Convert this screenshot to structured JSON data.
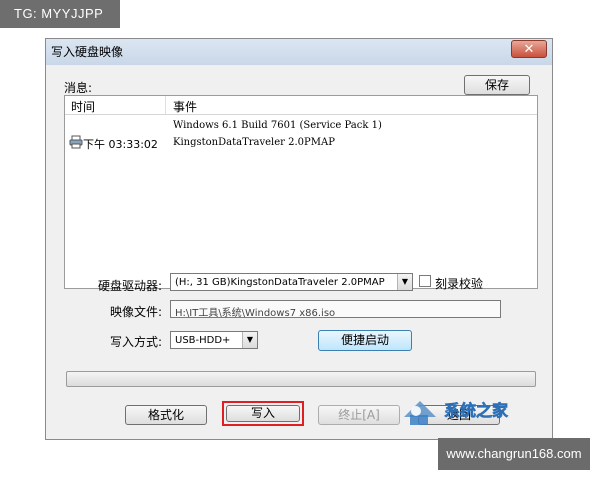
{
  "watermarks": {
    "top": "TG: MYYJJPP",
    "bottom": "www.changrun168.com",
    "logo_text": "系统之家"
  },
  "window": {
    "title": "写入硬盘映像",
    "close_symbol": "✕"
  },
  "messages": {
    "label": "消息:",
    "save_button": "保存",
    "columns": [
      "时间",
      "事件"
    ],
    "rows": [
      {
        "time": "",
        "event": "Windows 6.1 Build 7601 (Service Pack 1)"
      },
      {
        "time": "下午 03:33:02",
        "event": "KingstonDataTraveler 2.0PMAP",
        "icon": "printer-icon"
      }
    ]
  },
  "form": {
    "drive_label": "硬盘驱动器:",
    "drive_value": "(H:, 31 GB)KingstonDataTraveler 2.0PMAP",
    "burn_verify_label": "刻录校验",
    "burn_verify_checked": false,
    "image_label": "映像文件:",
    "image_value": "H:\\IT工具\\系统\\Windows7 x86.iso",
    "write_mode_label": "写入方式:",
    "write_mode_value": "USB-HDD+",
    "quick_boot_button": "便捷启动"
  },
  "progress": {
    "value": 0
  },
  "buttons": {
    "format": "格式化",
    "write": "写入",
    "stop": "终止[A]",
    "back": "返回"
  },
  "colors": {
    "highlight": "#e02020",
    "titlebar": "#c9d7e8",
    "close": "#c8513c"
  }
}
